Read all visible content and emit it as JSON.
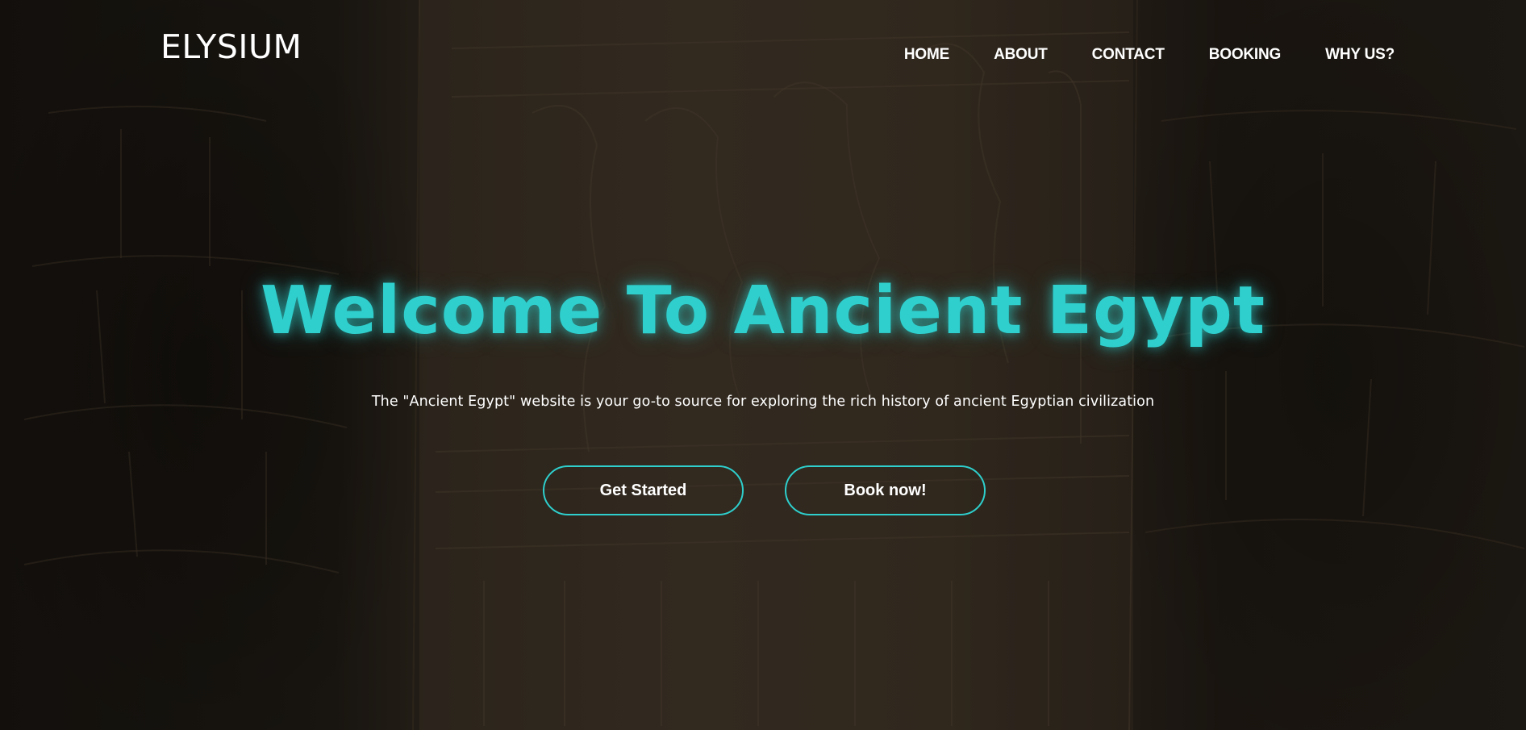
{
  "header": {
    "logo_text": "ELYSIUM",
    "nav": [
      {
        "label": "HOME"
      },
      {
        "label": "ABOUT"
      },
      {
        "label": "CONTACT"
      },
      {
        "label": "BOOKING"
      },
      {
        "label": "WHY US?"
      }
    ]
  },
  "hero": {
    "title": "Welcome To Ancient Egypt",
    "subtitle": "The \"Ancient Egypt\" website is your go-to source for exploring the rich history of ancient Egyptian civilization",
    "buttons": {
      "get_started": "Get Started",
      "book_now": "Book now!"
    }
  },
  "colors": {
    "accent": "#2ecfcd",
    "text": "#ffffff",
    "background": "#2a241c"
  }
}
